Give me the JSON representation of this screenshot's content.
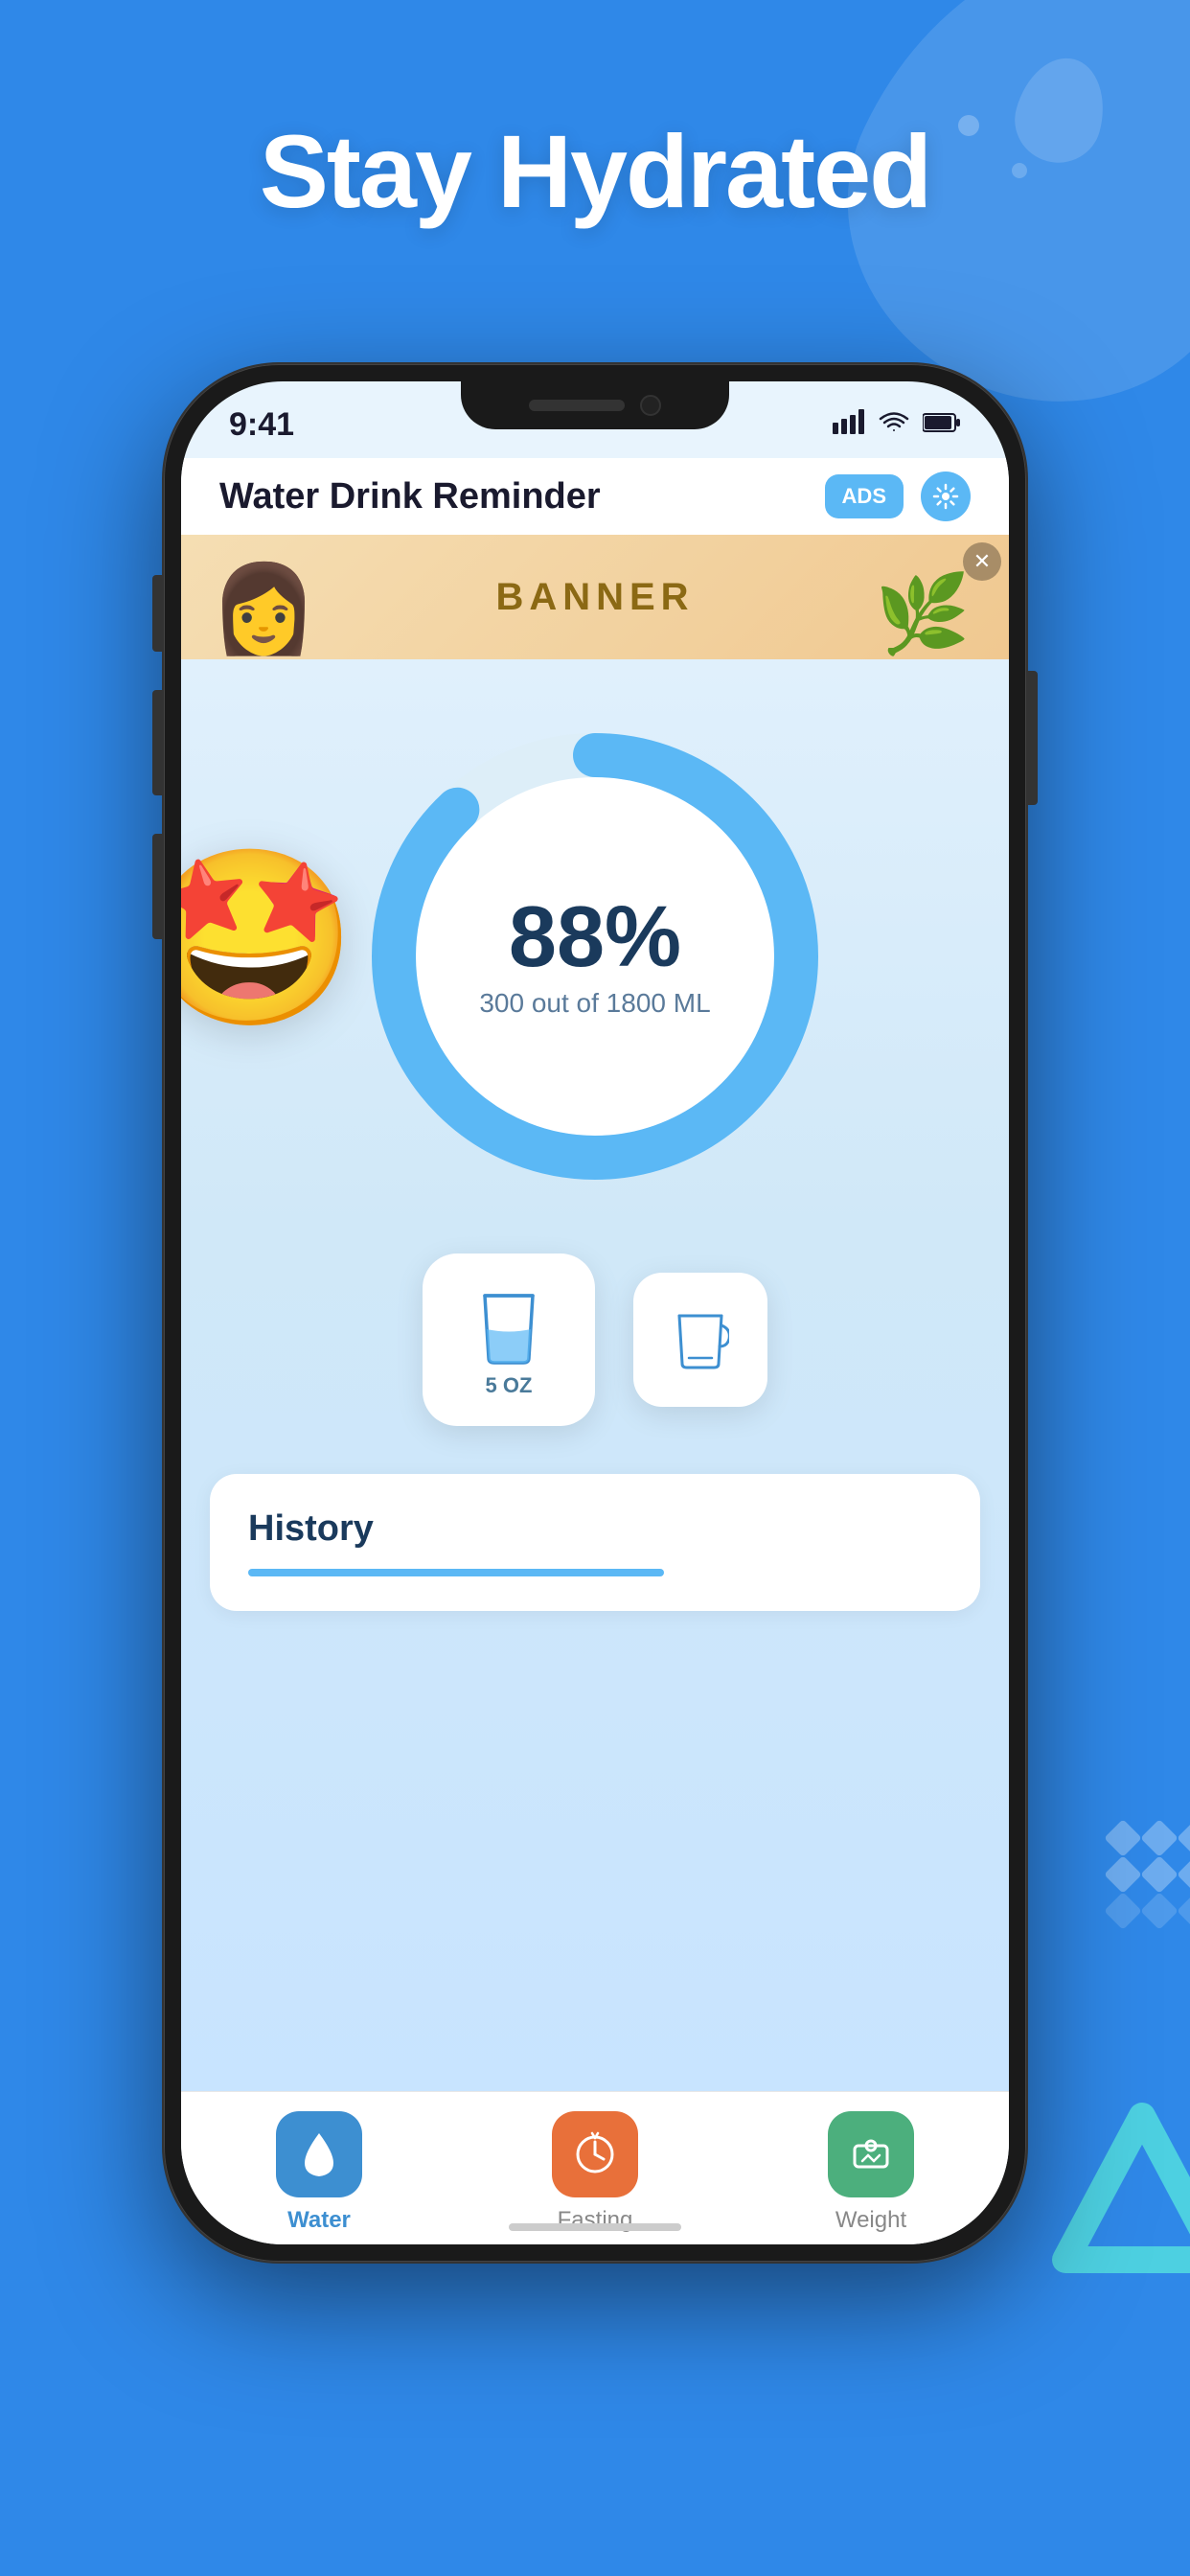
{
  "background": {
    "color": "#2F88E8"
  },
  "headline": {
    "text": "Stay Hydrated"
  },
  "status_bar": {
    "time": "9:41",
    "signal": "▌▌▌",
    "wifi": "wifi",
    "battery": "battery"
  },
  "app_header": {
    "title": "Water Drink Reminder",
    "ads_label": "ADS",
    "settings_icon": "⚙"
  },
  "banner": {
    "text": "BANNER",
    "close_icon": "✕"
  },
  "progress": {
    "percent": "88%",
    "detail": "300 out of 1800 ML",
    "value": 88,
    "emoji": "🤩"
  },
  "cup_buttons": {
    "main_oz": "5\nOZ",
    "secondary_icon": "⊟"
  },
  "history": {
    "title": "History"
  },
  "tabs": [
    {
      "label": "Water",
      "icon": "💧",
      "active": true
    },
    {
      "label": "Fasting",
      "icon": "⏱",
      "active": false
    },
    {
      "label": "Weight",
      "icon": "💬",
      "active": false
    }
  ],
  "triangle_logo": {
    "color": "#4dd0e1"
  }
}
